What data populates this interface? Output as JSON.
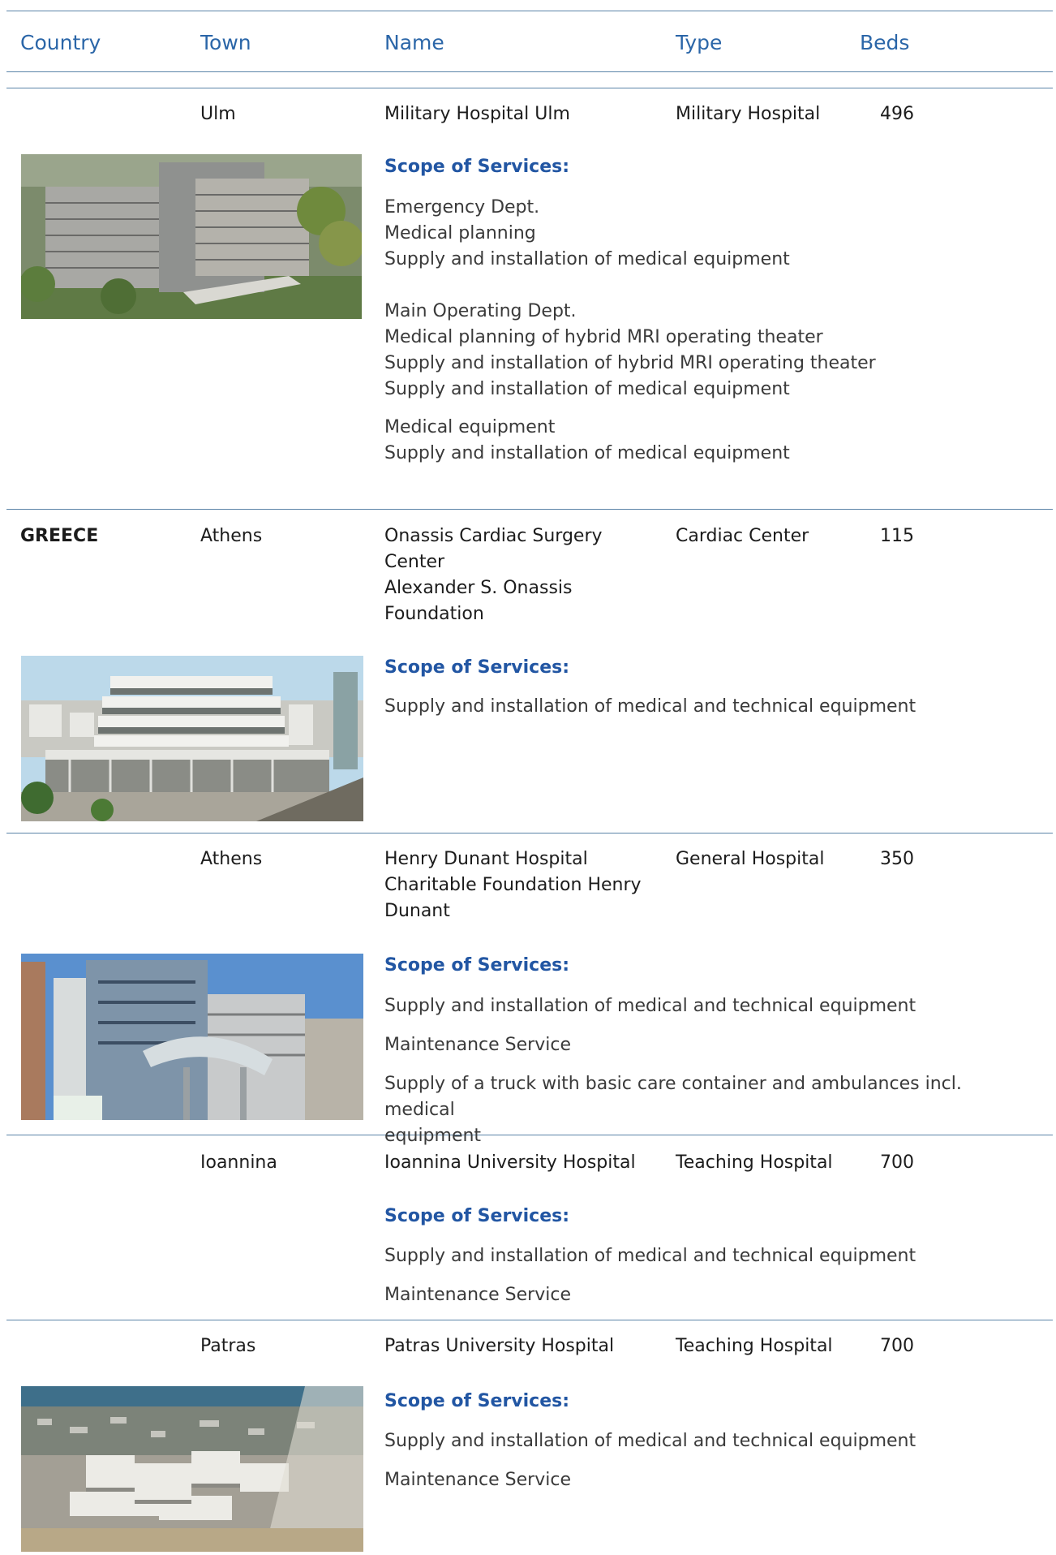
{
  "header": {
    "country": "Country",
    "town": "Town",
    "name": "Name",
    "type": "Type",
    "beds": "Beds"
  },
  "scope_label": "Scope of Services:",
  "entries": [
    {
      "country": "",
      "town": "Ulm",
      "name_lines": [
        "Military Hospital Ulm"
      ],
      "type": "Military Hospital",
      "beds": "496",
      "service_groups": [
        [
          "Emergency Dept.",
          "Medical planning",
          "Supply and installation of medical equipment"
        ],
        [
          "Main Operating Dept.",
          "Medical planning of hybrid MRI operating theater",
          "Supply and installation of hybrid MRI operating theater",
          "Supply and installation of medical equipment"
        ],
        [
          "Medical equipment",
          "Supply and installation of medical equipment"
        ]
      ]
    },
    {
      "country": "GREECE",
      "town": "Athens",
      "name_lines": [
        "Onassis Cardiac Surgery",
        "Center",
        "Alexander S. Onassis",
        "Foundation"
      ],
      "type": "Cardiac Center",
      "beds": "115",
      "service_groups": [
        [
          "Supply and installation of medical and technical equipment"
        ]
      ]
    },
    {
      "country": "",
      "town": "Athens",
      "name_lines": [
        "Henry Dunant Hospital",
        "Charitable Foundation Henry",
        "Dunant"
      ],
      "type": "General Hospital",
      "beds": "350",
      "service_groups": [
        [
          "Supply and installation of medical and technical equipment"
        ],
        [
          "Maintenance Service"
        ],
        [
          "Supply of a truck with basic care container and ambulances incl. medical",
          "equipment"
        ]
      ]
    },
    {
      "country": "",
      "town": "Ioannina",
      "name_lines": [
        "Ioannina University Hospital"
      ],
      "type": "Teaching Hospital",
      "beds": "700",
      "service_groups": [
        [
          "Supply and installation of medical and technical equipment"
        ],
        [
          "Maintenance Service"
        ]
      ]
    },
    {
      "country": "",
      "town": "Patras",
      "name_lines": [
        "Patras University Hospital"
      ],
      "type": "Teaching Hospital",
      "beds": "700",
      "service_groups": [
        [
          "Supply and installation of medical and technical equipment"
        ],
        [
          "Maintenance Service"
        ]
      ]
    }
  ]
}
